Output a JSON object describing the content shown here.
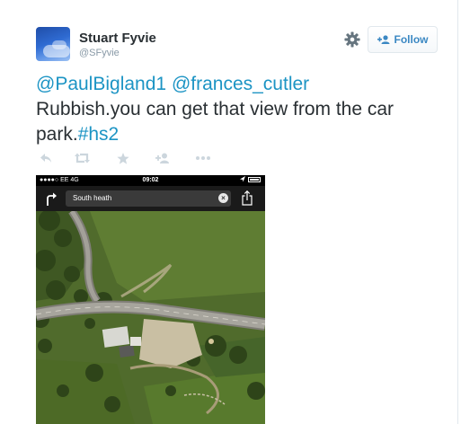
{
  "tweet": {
    "author": {
      "name": "Stuart Fyvie",
      "handle": "@SFyvie"
    },
    "follow_label": "Follow",
    "text": {
      "mention_1": "@PaulBigland1",
      "mention_2": "@frances_cutler",
      "body": "Rubbish.you can get that view from the car park.",
      "hashtag": "#hs2"
    },
    "actions": [
      "reply-icon",
      "retweet-icon",
      "favorite-icon",
      "follow-icon",
      "more-icon"
    ]
  },
  "media": {
    "status_bar": {
      "carrier": "●●●●○ EE  4G",
      "time": "09:02"
    },
    "search_value": "South heath"
  },
  "colors": {
    "link": "#1c94c4",
    "text": "#292f33",
    "muted": "#8899a6",
    "follow_text": "#3b88c3"
  }
}
